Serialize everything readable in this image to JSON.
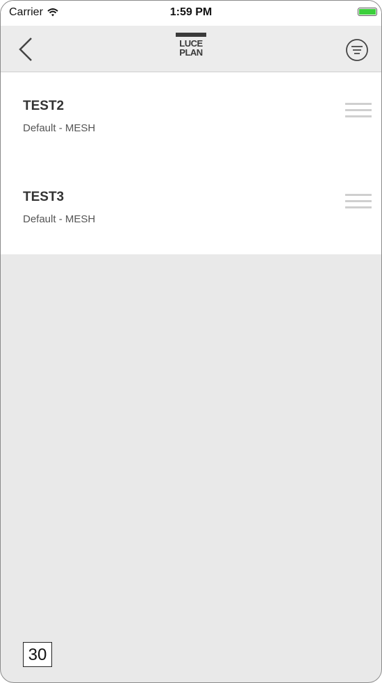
{
  "status_bar": {
    "carrier": "Carrier",
    "time": "1:59 PM",
    "battery_color": "#3ccf3c"
  },
  "nav": {
    "back_icon": "chevron-left-icon",
    "logo": {
      "line1": "LUCE",
      "line2": "PLAN"
    },
    "filter_icon": "filter-lines-icon"
  },
  "list": {
    "items": [
      {
        "title": "TEST2",
        "subtitle": "Default - MESH"
      },
      {
        "title": "TEST3",
        "subtitle": "Default - MESH"
      }
    ]
  },
  "badge": {
    "text": "30"
  }
}
